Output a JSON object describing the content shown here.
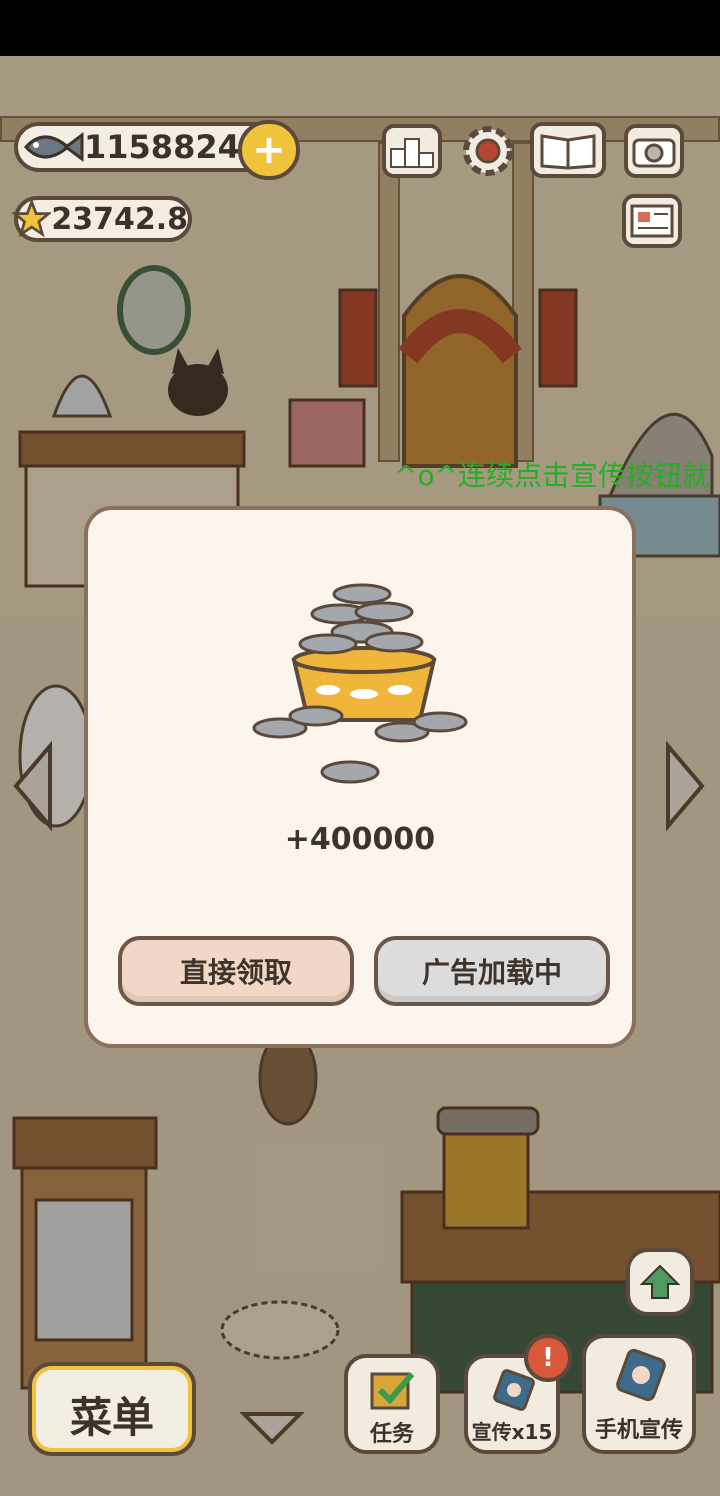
{
  "hud": {
    "fish_count": "1158824",
    "star_count": "23742.8"
  },
  "ticker": {
    "text": "^o^连续点击宣传按钮就"
  },
  "reward_dialog": {
    "amount": "+400000",
    "claim_label": "直接领取",
    "ad_label": "广告加载中"
  },
  "bottom_bar": {
    "menu_label": "菜单",
    "tasks_label": "任务",
    "promote_label": "宣传x15",
    "phone_promote_label": "手机宣传"
  },
  "colors": {
    "accent_gold": "#f0c33c",
    "claim_button": "#f3d7c6",
    "ad_button": "#dcdcdc",
    "ticker_green": "#25b024"
  }
}
